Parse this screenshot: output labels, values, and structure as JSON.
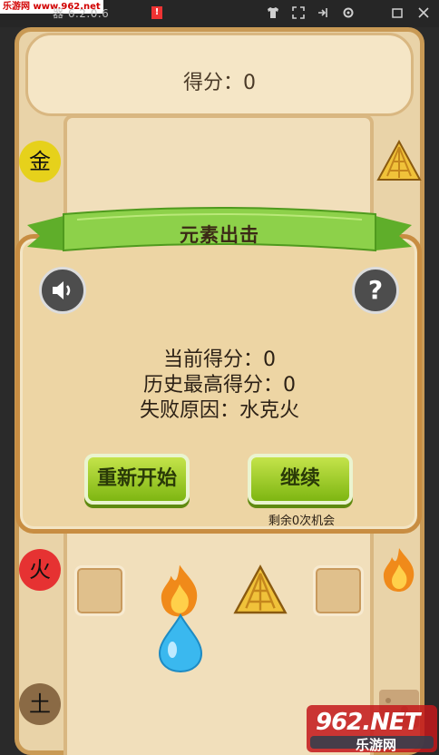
{
  "titlebar": {
    "watermark": "乐游网 www.962.net",
    "title": "器 6.2.0.6",
    "warning": "!",
    "icons": [
      "shirt-icon",
      "expand-icon",
      "unpin-icon",
      "settings-icon",
      "restore-icon",
      "close-icon"
    ]
  },
  "game": {
    "score_label": "得分：0",
    "elements": {
      "metal": "金",
      "fire": "火",
      "earth": "土"
    }
  },
  "dialog": {
    "ribbon_title": "元素出击",
    "current_score": "当前得分：0",
    "best_score": "历史最高得分：0",
    "fail_reason": "失败原因：水克火",
    "restart_label": "重新开始",
    "continue_label": "继续",
    "chances_left": "剩余0次机会"
  },
  "watermark": {
    "brand": "962.NET",
    "brand_cn": "乐游网"
  },
  "colors": {
    "metal": "#e6d11b",
    "fire": "#e63232",
    "earth": "#8a6a45",
    "button_green": "#9ccd22",
    "board": "#e9d3a8"
  }
}
